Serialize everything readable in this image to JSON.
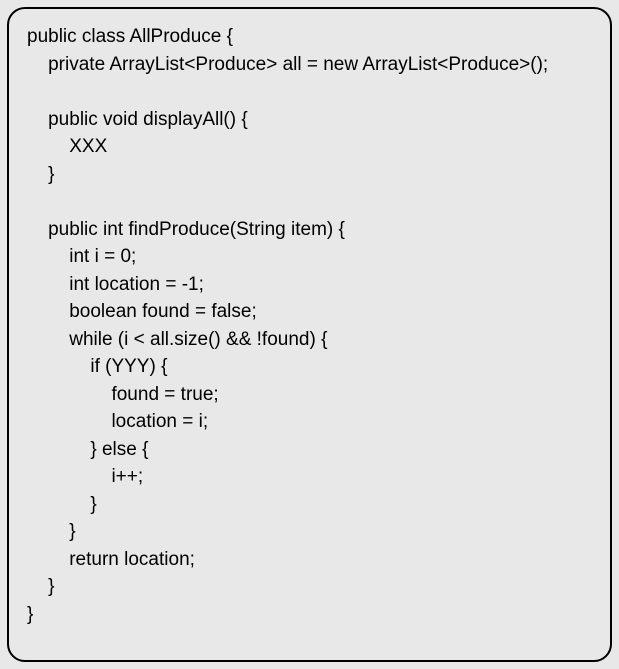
{
  "code": {
    "lines": [
      "public class AllProduce {",
      "    private ArrayList<Produce> all = new ArrayList<Produce>();",
      "",
      "    public void displayAll() {",
      "        XXX",
      "    }",
      "",
      "    public int findProduce(String item) {",
      "        int i = 0;",
      "        int location = -1;",
      "        boolean found = false;",
      "        while (i < all.size() && !found) {",
      "            if (YYY) {",
      "                found = true;",
      "                location = i;",
      "            } else {",
      "                i++;",
      "            }",
      "        }",
      "        return location;",
      "    }",
      "}"
    ]
  }
}
